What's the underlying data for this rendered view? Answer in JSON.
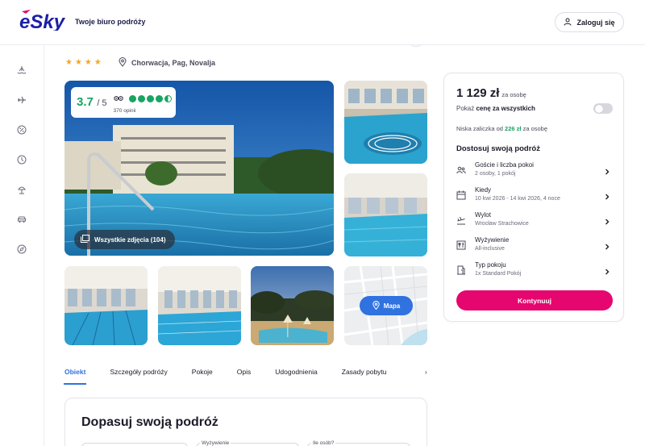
{
  "header": {
    "brand": "eSky",
    "tagline": "Twoje biuro podróży",
    "login_label": "Zaloguj się"
  },
  "sidebar": {
    "items": [
      "ferry-icon",
      "plane-icon",
      "percent-badge-icon",
      "clock-icon",
      "beach-umbrella-icon",
      "car-icon",
      "compass-icon"
    ]
  },
  "hotel": {
    "stars": 4,
    "stars_text": "★★★★",
    "location": "Chorwacja, Pag, Novalja"
  },
  "rating": {
    "score": "3.7",
    "scale": "/ 5",
    "reviews": "370 opinii",
    "dots_filled": 4,
    "dots_half": 1,
    "dots_empty": 0
  },
  "gallery": {
    "all_photos_label": "Wszystkie zdjęcia (104)",
    "map_label": "Mapa"
  },
  "tabs": [
    "Obiekt",
    "Szczegóły podróży",
    "Pokoje",
    "Opis",
    "Udogodnienia",
    "Zasady pobytu"
  ],
  "active_tab": "Obiekt",
  "bottom": {
    "title": "Dopasuj swoją podróż",
    "field_labels": [
      "Wyżywienie",
      "Ile osób?"
    ]
  },
  "booking": {
    "price": "1 129 zł",
    "price_per": "za osobę",
    "total_prefix": "Pokaż",
    "total_bold": "cenę za wszystkich",
    "toggle_on": false,
    "deposit_prefix": "Niska zaliczka od",
    "deposit_amount": "226 zł",
    "deposit_suffix": "za osobę",
    "adjust_title": "Dostosuj swoją podróż",
    "options": [
      {
        "label": "Goście i liczba pokoi",
        "value": "2 osoby, 1 pokój",
        "icon": "guests-icon"
      },
      {
        "label": "Kiedy",
        "value": "10 kwi 2026 - 14 kwi 2026, 4 noce",
        "icon": "calendar-icon"
      },
      {
        "label": "Wylot",
        "value": "Wrocław Strachowice",
        "icon": "takeoff-icon"
      },
      {
        "label": "Wyżywienie",
        "value": "All-inclusive",
        "icon": "meal-icon"
      },
      {
        "label": "Typ pokoju",
        "value": "1x Standard Pokój",
        "icon": "door-icon"
      }
    ],
    "continue_label": "Kontynuuj"
  },
  "colors": {
    "brand_blue": "#2f72e0",
    "rating_green": "#19a463",
    "cta_pink": "#e6066f",
    "star_orange": "#f5a623"
  }
}
